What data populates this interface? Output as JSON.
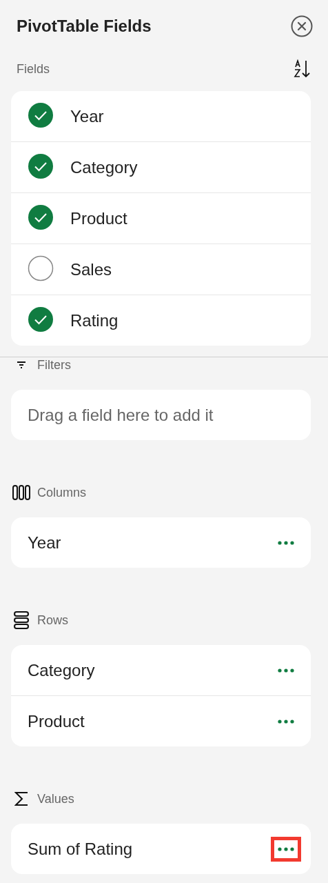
{
  "header": {
    "title": "PivotTable Fields"
  },
  "fields": {
    "label": "Fields",
    "items": [
      {
        "name": "Year",
        "checked": true
      },
      {
        "name": "Category",
        "checked": true
      },
      {
        "name": "Product",
        "checked": true
      },
      {
        "name": "Sales",
        "checked": false
      },
      {
        "name": "Rating",
        "checked": true
      }
    ]
  },
  "areas": [
    {
      "kind": "filters",
      "label": "Filters",
      "placeholder": "Drag a field here to add it"
    },
    {
      "kind": "columns",
      "label": "Columns",
      "items": [
        {
          "name": "Year",
          "highlighted": false
        }
      ]
    },
    {
      "kind": "rows",
      "label": "Rows",
      "items": [
        {
          "name": "Category",
          "highlighted": false
        },
        {
          "name": "Product",
          "highlighted": false
        }
      ]
    },
    {
      "kind": "values",
      "label": "Values",
      "items": [
        {
          "name": "Sum of Rating",
          "highlighted": true
        }
      ]
    }
  ]
}
